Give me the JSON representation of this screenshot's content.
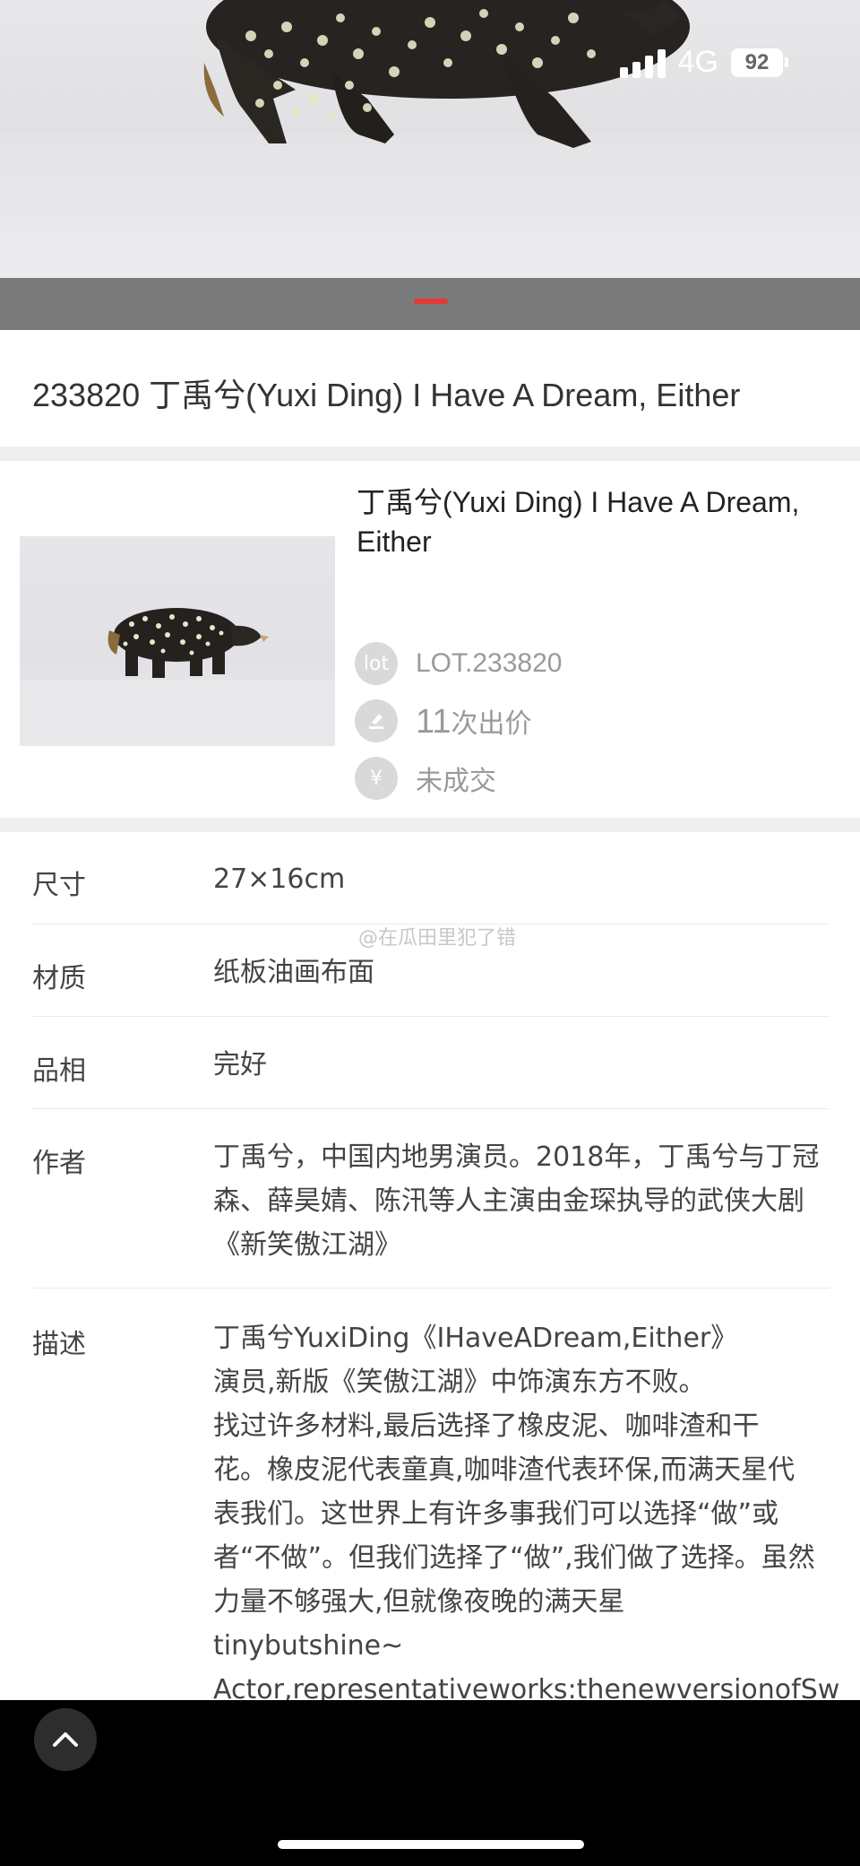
{
  "status_bar": {
    "network": "4G",
    "battery": "92"
  },
  "carousel": {
    "accent_color": "#e53935"
  },
  "header": {
    "title": "233820 丁禹兮(Yuxi Ding) I Have A Dream, Either"
  },
  "lot": {
    "name": "丁禹兮(Yuxi Ding) I Have A Dream, Either",
    "lot_icon": "lot",
    "lot_number": "LOT.233820",
    "bids_count": "11",
    "bids_suffix": "次出价",
    "result_icon": "¥",
    "result": "未成交"
  },
  "watermark": "@在瓜田里犯了错",
  "details": [
    {
      "label": "尺寸",
      "value": "27×16cm"
    },
    {
      "label": "材质",
      "value": "纸板油画布面"
    },
    {
      "label": "品相",
      "value": "完好"
    },
    {
      "label": "作者",
      "value": "丁禹兮，中国内地男演员。2018年，丁禹兮与丁冠森、薛昊婧、陈汛等人主演由金琛执导的武侠大剧《新笑傲江湖》"
    },
    {
      "label": "描述",
      "lines": [
        "丁禹兮YuxiDing《IHaveADream,Either》",
        "演员,新版《笑傲江湖》中饰演东方不败。",
        "找过许多材料,最后选择了橡皮泥、咖啡渣和干",
        "花。橡皮泥代表童真,咖啡渣代表环保,而满天星代",
        "表我们。这世界上有许多事我们可以选择“做”或",
        "者“不做”。但我们选择了“做”,我们做了选择。虽然",
        "力量不够强大,但就像夜晚的满天星",
        "tinybutshine~",
        "Actor,representativeworks:thenewversionofSw"
      ]
    }
  ]
}
